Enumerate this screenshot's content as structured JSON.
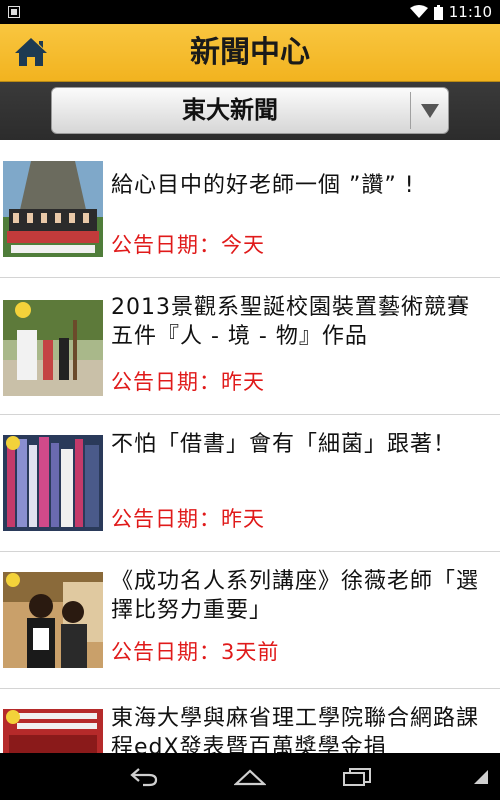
{
  "status_bar": {
    "time": "11:10"
  },
  "header": {
    "title": "新聞中心"
  },
  "category": {
    "selected": "東大新聞"
  },
  "news": [
    {
      "title": "給心目中的好老師一個 ”讚” !",
      "date": "公告日期：今天"
    },
    {
      "title": "2013景觀系聖誕校園裝置藝術競賽  五件『人 - 境 - 物』作品",
      "date": "公告日期：昨天"
    },
    {
      "title": "不怕「借書」會有「細菌」跟著！",
      "date": "公告日期：昨天"
    },
    {
      "title": "《成功名人系列講座》徐薇老師「選擇比努力重要」",
      "date": "公告日期：3天前"
    },
    {
      "title": "東海大學與麻省理工學院聯合網路課程edX發表暨百萬獎學金捐",
      "date": ""
    }
  ],
  "colors": {
    "header": "#f2b31f",
    "date": "#e01a1a",
    "category_bar": "#333333"
  },
  "icons": {
    "home": "home-icon",
    "dropdown": "triangle-down-icon",
    "back": "back-icon",
    "nav_home": "nav-home-icon",
    "recents": "recents-icon"
  }
}
